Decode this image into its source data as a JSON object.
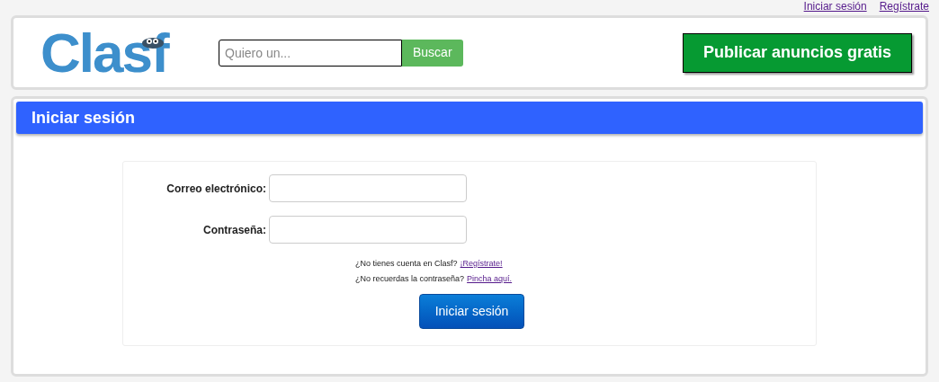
{
  "top_links": [
    "Iniciar sesión",
    "Regístrate"
  ],
  "header": {
    "logo": "Clasf",
    "search": {
      "placeholder": "Quiero un...",
      "button": "Buscar"
    },
    "publish_button": "Publicar anuncios gratis"
  },
  "panel": {
    "title": "Iniciar sesión",
    "fields": [
      {
        "label": "Correo electrónico:"
      },
      {
        "label": "Contraseña:"
      }
    ],
    "hints": [
      {
        "text": "¿No tienes cuenta en Clasf?",
        "link": "¡Regístrate!"
      },
      {
        "text": "¿No recuerdas la contraseña?",
        "link": "Pincha aquí."
      }
    ],
    "submit": "Iniciar sesión"
  }
}
